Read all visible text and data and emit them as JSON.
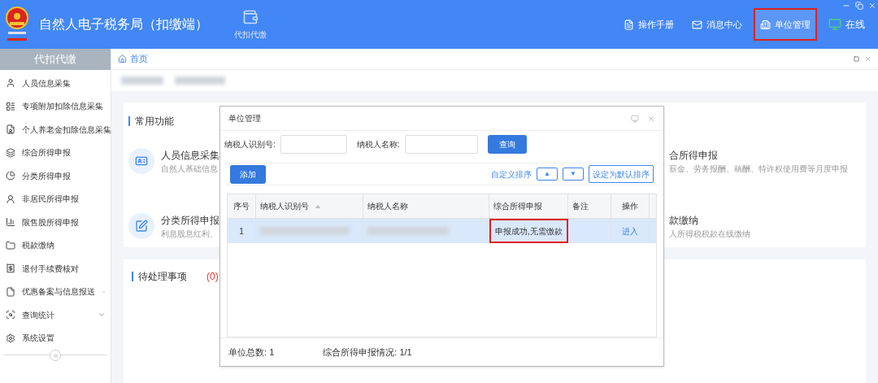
{
  "app": {
    "title": "自然人电子税务局（扣缴端）",
    "module": "代扣代缴"
  },
  "top_nav": [
    {
      "label": "操作手册",
      "kind": "manual",
      "highlighted": false
    },
    {
      "label": "消息中心",
      "kind": "mail",
      "highlighted": false
    },
    {
      "label": "单位管理",
      "kind": "unit",
      "highlighted": true
    },
    {
      "label": "在线",
      "kind": "online",
      "highlighted": false
    }
  ],
  "sidebar": {
    "title": "代扣代缴",
    "items": [
      {
        "label": "人员信息采集",
        "kind": "link"
      },
      {
        "label": "专项附加扣除信息采集",
        "kind": "link"
      },
      {
        "label": "个人养老金扣除信息采集",
        "kind": "link"
      },
      {
        "label": "综合所得申报",
        "kind": "link"
      },
      {
        "label": "分类所得申报",
        "kind": "link"
      },
      {
        "label": "非居民所得申报",
        "kind": "link"
      },
      {
        "label": "限售股所得申报",
        "kind": "link"
      },
      {
        "label": "税款缴纳",
        "kind": "link"
      },
      {
        "label": "退付手续费核对",
        "kind": "link"
      },
      {
        "label": "优惠备案与信息报送",
        "kind": "group"
      },
      {
        "label": "查询统计",
        "kind": "group"
      },
      {
        "label": "系统设置",
        "kind": "link"
      }
    ]
  },
  "breadcrumb": "首页",
  "common_functions": {
    "title": "常用功能",
    "items": [
      {
        "title": "人员信息采集",
        "desc": "自然人基础信息"
      },
      {
        "title": "合所得申报",
        "desc": "薪金、劳务报酬、稿酬、特许权使用费等月度申报"
      },
      {
        "title": "分类所得申报",
        "desc": "利息股息红利、"
      },
      {
        "title": "款缴纳",
        "desc": "人所得税税款在线缴纳"
      }
    ]
  },
  "pending": {
    "title": "待处理事项",
    "count": "(0)"
  },
  "dialog": {
    "title": "单位管理",
    "filters": [
      {
        "label": "纳税人识别号:"
      },
      {
        "label": "纳税人名称:"
      }
    ],
    "query_button": "查询",
    "add_button": "添加",
    "custom_sort": "自定义排序",
    "up": "▲",
    "down": "▼",
    "default_sort": "设定为默认排序",
    "columns": [
      "序号",
      "纳税人识别号",
      "纳税人名称",
      "综合所得申报",
      "备注",
      "操作"
    ],
    "rows": [
      {
        "index": "1",
        "status": "申报成功,无需缴款",
        "status_highlighted": true,
        "action": "进入",
        "selected": true
      }
    ],
    "footer": [
      {
        "label": "单位总数:",
        "value": "1"
      },
      {
        "label": "综合所得申报情况:",
        "value": "1/1"
      }
    ]
  }
}
